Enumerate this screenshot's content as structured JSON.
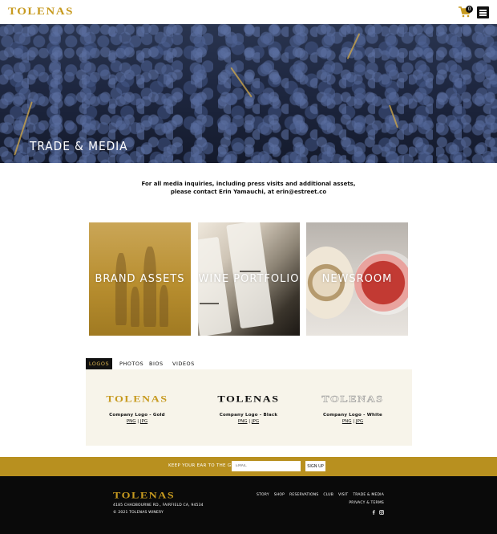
{
  "header": {
    "logo_text": "TOLENAS",
    "cart_count": "0",
    "icons": [
      "cart-icon",
      "hamburger-menu-icon"
    ]
  },
  "hero": {
    "title": "TRADE & MEDIA"
  },
  "intro": {
    "text": "For all media inquiries, including press visits and additional assets, please contact Erin Yamauchi, at erin@estreet.co"
  },
  "cards": [
    {
      "label": "BRAND ASSETS"
    },
    {
      "label": "WINE PORTFOLIO"
    },
    {
      "label": "NEWSROOM"
    }
  ],
  "tabs": [
    {
      "label": "LOGOS",
      "active": true
    },
    {
      "label": "PHOTOS",
      "active": false
    },
    {
      "label": "BIOS",
      "active": false
    },
    {
      "label": "VIDEOS",
      "active": false
    }
  ],
  "logos": [
    {
      "wordmark": "TOLENAS",
      "name": "Company Logo - Gold",
      "png": "PNG",
      "sep": " | ",
      "jpg": "JPG"
    },
    {
      "wordmark": "TOLENAS",
      "name": "Company Logo - Black",
      "png": "PNG",
      "sep": " | ",
      "jpg": "JPG"
    },
    {
      "wordmark": "TOLENAS",
      "name": "Company Logo - White",
      "png": "PNG",
      "sep": " | ",
      "jpg": "JPG"
    }
  ],
  "newsletter": {
    "label": "KEEP YOUR EAR TO THE GROUND",
    "placeholder": "EMAIL",
    "button": "SIGN UP"
  },
  "footer": {
    "logo_text": "TOLENAS",
    "address": "4185 CHADBOURNE RD., FAIRFIELD CA, 94534",
    "copyright": "© 2021 TOLENAS WINERY",
    "nav": [
      "STORY",
      "SHOP",
      "RESERVATIONS",
      "CLUB",
      "VISIT",
      "TRADE & MEDIA"
    ],
    "privacy": "PRIVACY & TERMS",
    "social_icons": [
      "facebook-icon",
      "instagram-icon"
    ]
  },
  "colors": {
    "brand_gold": "#c79a1f",
    "newsletter_bar": "#b8901f",
    "footer_bg": "#0a0a0a",
    "panel_bg": "#f7f4ea"
  }
}
